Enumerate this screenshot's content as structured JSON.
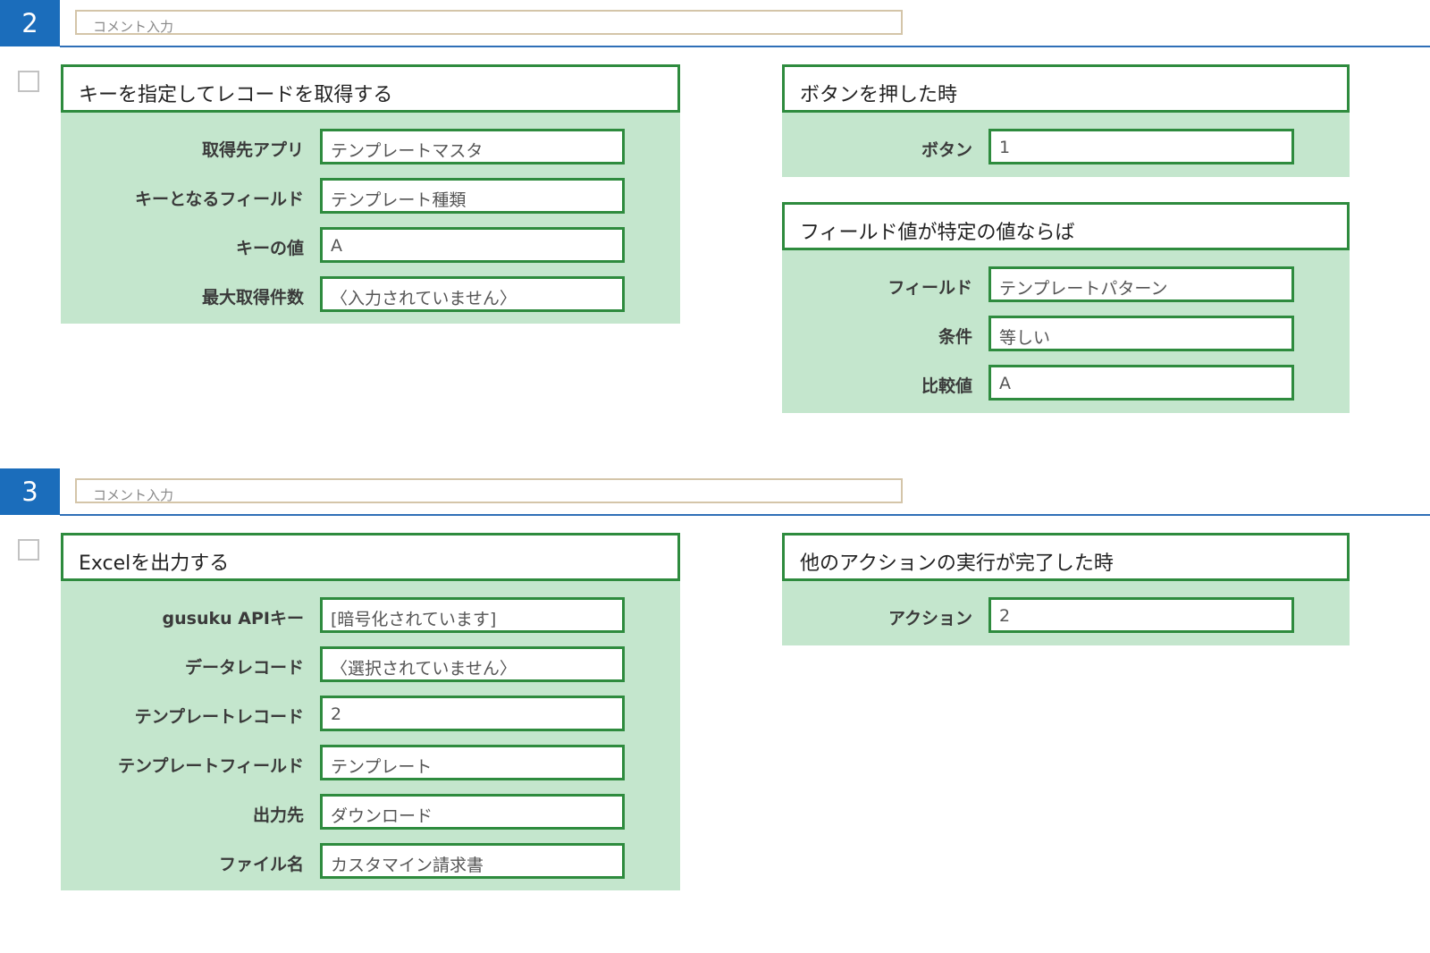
{
  "steps": [
    {
      "number": "2",
      "comment_placeholder": "コメント入力",
      "action": {
        "title": "キーを指定してレコードを取得する",
        "fields": [
          {
            "label": "取得先アプリ",
            "value": "テンプレートマスタ"
          },
          {
            "label": "キーとなるフィールド",
            "value": "テンプレート種類"
          },
          {
            "label": "キーの値",
            "value": "A"
          },
          {
            "label": "最大取得件数",
            "value": "〈入力されていません〉"
          }
        ]
      },
      "triggers": [
        {
          "title": "ボタンを押した時",
          "fields": [
            {
              "label": "ボタン",
              "value": "1"
            }
          ]
        },
        {
          "title": "フィールド値が特定の値ならば",
          "fields": [
            {
              "label": "フィールド",
              "value": "テンプレートパターン"
            },
            {
              "label": "条件",
              "value": "等しい"
            },
            {
              "label": "比較値",
              "value": "A"
            }
          ]
        }
      ]
    },
    {
      "number": "3",
      "comment_placeholder": "コメント入力",
      "action": {
        "title": "Excelを出力する",
        "fields": [
          {
            "label": "gusuku APIキー",
            "value": "[暗号化されています]"
          },
          {
            "label": "データレコード",
            "value": "〈選択されていません〉"
          },
          {
            "label": "テンプレートレコード",
            "value": "2"
          },
          {
            "label": "テンプレートフィールド",
            "value": "テンプレート"
          },
          {
            "label": "出力先",
            "value": "ダウンロード"
          },
          {
            "label": "ファイル名",
            "value": "カスタマイン請求書"
          }
        ]
      },
      "triggers": [
        {
          "title": "他のアクションの実行が完了した時",
          "fields": [
            {
              "label": "アクション",
              "value": "2"
            }
          ]
        }
      ]
    }
  ],
  "colors": {
    "step_badge": "#1b6dbb",
    "panel_bg": "#c4e6cd",
    "panel_border": "#2e8b3e",
    "comment_border": "#d4c5a9"
  }
}
